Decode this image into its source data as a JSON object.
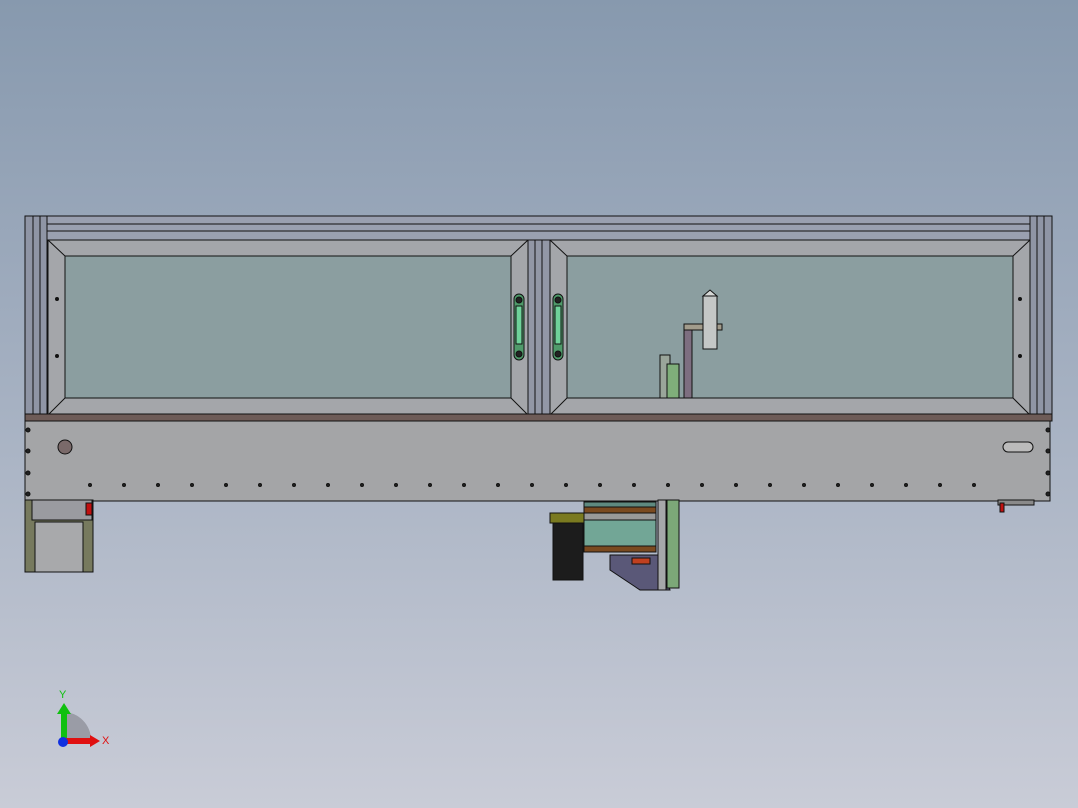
{
  "viewport": {
    "name": "cad-graphics-area"
  },
  "triad": {
    "x_label": "X",
    "y_label": "Y",
    "x_color": "#e01010",
    "y_color": "#10c010",
    "z_color": "#1030e0"
  },
  "colors": {
    "frame": "#a7a9ae",
    "glass": "#8b9ea0",
    "base": "#a4a5a7",
    "strip": "#6e5c58",
    "handle": "#5fcf8a"
  }
}
